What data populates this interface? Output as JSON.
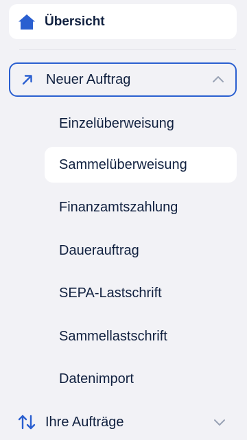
{
  "nav": {
    "overview": {
      "label": "Übersicht",
      "icon": "home-icon"
    },
    "new_order": {
      "label": "Neuer Auftrag",
      "icon": "arrow-up-right-icon",
      "expanded": true,
      "chevron": "chevron-up-icon",
      "subitems": [
        {
          "label": "Einzelüberweisung",
          "active": false
        },
        {
          "label": "Sammelüberweisung",
          "active": true
        },
        {
          "label": "Finanzamtszahlung",
          "active": false
        },
        {
          "label": "Dauerauftrag",
          "active": false
        },
        {
          "label": "SEPA-Lastschrift",
          "active": false
        },
        {
          "label": "Sammellastschrift",
          "active": false
        },
        {
          "label": "Datenimport",
          "active": false
        }
      ]
    },
    "orders": {
      "label": "Ihre Aufträge",
      "icon": "sort-arrows-icon",
      "expanded": false,
      "chevron": "chevron-down-icon"
    }
  },
  "colors": {
    "accent": "#2a5fd0",
    "text": "#10203f",
    "background": "#f2f2f6",
    "active_bg": "#ffffff"
  }
}
